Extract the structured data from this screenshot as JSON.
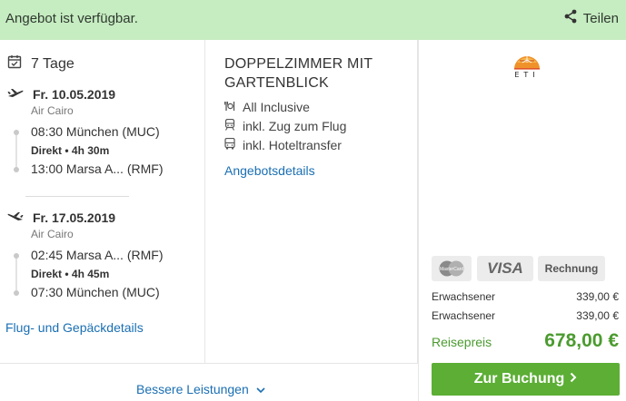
{
  "header": {
    "availability": "Angebot ist verfügbar.",
    "share_label": "Teilen",
    "background_color": "#c6ecc1"
  },
  "trip": {
    "duration": "7 Tage"
  },
  "outbound": {
    "date": "Fr. 10.05.2019",
    "airline": "Air Cairo",
    "departure": "08:30 München (MUC)",
    "info_direct": "Direkt",
    "info_duration": "4h 30m",
    "arrival": "13:00 Marsa A... (RMF)"
  },
  "inbound": {
    "date": "Fr. 17.05.2019",
    "airline": "Air Cairo",
    "departure": "02:45 Marsa A... (RMF)",
    "info_direct": "Direkt",
    "info_duration": "4h 45m",
    "arrival": "07:30 München (MUC)"
  },
  "flight_details_link": "Flug- und Gepäckdetails",
  "room": {
    "title": "DOPPELZIMMER MIT GARTENBLICK",
    "features": [
      {
        "icon": "cutlery-icon",
        "label": "All Inclusive"
      },
      {
        "icon": "train-icon",
        "label": "inkl. Zug zum Flug"
      },
      {
        "icon": "bus-icon",
        "label": "inkl. Hoteltransfer"
      }
    ],
    "details_link": "Angebotsdetails"
  },
  "operator": {
    "logo_text": "ETI"
  },
  "payment": {
    "methods": [
      "MasterCard",
      "VISA",
      "Rechnung"
    ]
  },
  "pricing": {
    "rows": [
      {
        "label": "Erwachsener",
        "value": "339,00 €"
      },
      {
        "label": "Erwachsener",
        "value": "339,00 €"
      }
    ],
    "total_label": "Reisepreis",
    "total_value": "678,00 €",
    "accent_color": "#4b9b2f"
  },
  "actions": {
    "book_label": "Zur Buchung",
    "book_color": "#5cae35",
    "better_label": "Bessere Leistungen"
  }
}
